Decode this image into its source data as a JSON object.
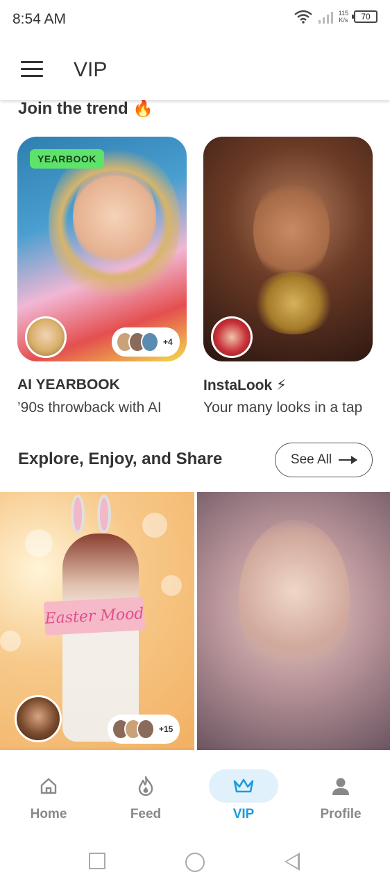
{
  "status_bar": {
    "time": "8:54 AM",
    "speed_value": "115",
    "speed_unit": "K/s",
    "battery": "70"
  },
  "app_bar": {
    "title": "VIP"
  },
  "trend_section": {
    "title": "Join the trend 🔥",
    "cards": [
      {
        "badge": "YEARBOOK",
        "more_count": "+4",
        "name": "AI YEARBOOK",
        "description": "’90s throwback with AI"
      },
      {
        "name": "InstaLook ⚡",
        "description": "Your many looks in a tap"
      }
    ]
  },
  "explore_section": {
    "title": "Explore, Enjoy, and Share",
    "see_all_label": "See All",
    "items": [
      {
        "sign_text": "Easter Mood",
        "more_count": "+15"
      },
      {}
    ]
  },
  "bottom_nav": {
    "items": [
      {
        "label": "Home",
        "icon": "home-icon"
      },
      {
        "label": "Feed",
        "icon": "flame-icon"
      },
      {
        "label": "VIP",
        "icon": "crown-icon",
        "active": true
      },
      {
        "label": "Profile",
        "icon": "person-icon"
      }
    ]
  },
  "colors": {
    "accent": "#1c9bd9",
    "accent_bg": "#e1f1fb",
    "badge_green": "#5ee36a"
  }
}
